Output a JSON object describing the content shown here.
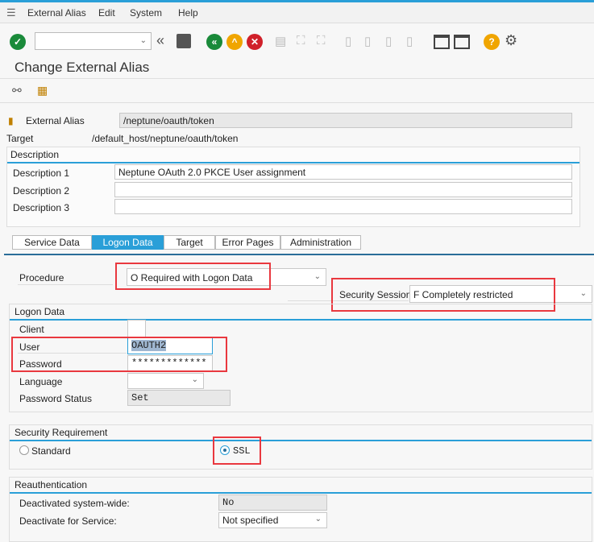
{
  "menu": {
    "items": [
      "External Alias",
      "Edit",
      "System",
      "Help"
    ]
  },
  "toolbar": {
    "command_value": "",
    "icons": [
      "enter-icon",
      "back-icon",
      "save-icon",
      "back-green-icon",
      "exit-icon",
      "cancel-icon",
      "print-icon",
      "find-icon",
      "find-next-icon",
      "first-page-icon",
      "previous-page-icon",
      "next-page-icon",
      "last-page-icon",
      "create-session-icon",
      "shortcut-icon",
      "help-icon",
      "settings-icon"
    ]
  },
  "title": "Change External Alias",
  "header": {
    "alias_label": "External Alias",
    "alias_value": "/neptune/oauth/token",
    "target_label": "Target",
    "target_value": "/default_host/neptune/oauth/token"
  },
  "description": {
    "title": "Description",
    "rows": [
      {
        "label": "Description 1",
        "value": "Neptune OAuth 2.0 PKCE User assignment"
      },
      {
        "label": "Description 2",
        "value": ""
      },
      {
        "label": "Description 3",
        "value": ""
      }
    ]
  },
  "tabs": [
    "Service Data",
    "Logon Data",
    "Target",
    "Error Pages",
    "Administration"
  ],
  "active_tab": "Logon Data",
  "procedure": {
    "label": "Procedure",
    "value": "O Required with Logon Data"
  },
  "security_session": {
    "label": "Security Session:",
    "value": "F Completely restricted"
  },
  "logon": {
    "title": "Logon Data",
    "client_label": "Client",
    "client_value": "",
    "user_label": "User",
    "user_value": "OAUTH2",
    "password_label": "Password",
    "password_value": "*************",
    "language_label": "Language",
    "language_value": "",
    "pw_status_label": "Password Status",
    "pw_status_value": "Set"
  },
  "security_req": {
    "title": "Security Requirement",
    "standard_label": "Standard",
    "ssl_label": "SSL",
    "selected": "SSL"
  },
  "reauth": {
    "title": "Reauthentication",
    "deact_sys_label": "Deactivated system-wide:",
    "deact_sys_value": "No",
    "deact_svc_label": "Deactivate for Service:",
    "deact_svc_value": "Not specified"
  },
  "colors": {
    "accent": "#2a9fd8",
    "highlight": "#e9383f"
  }
}
